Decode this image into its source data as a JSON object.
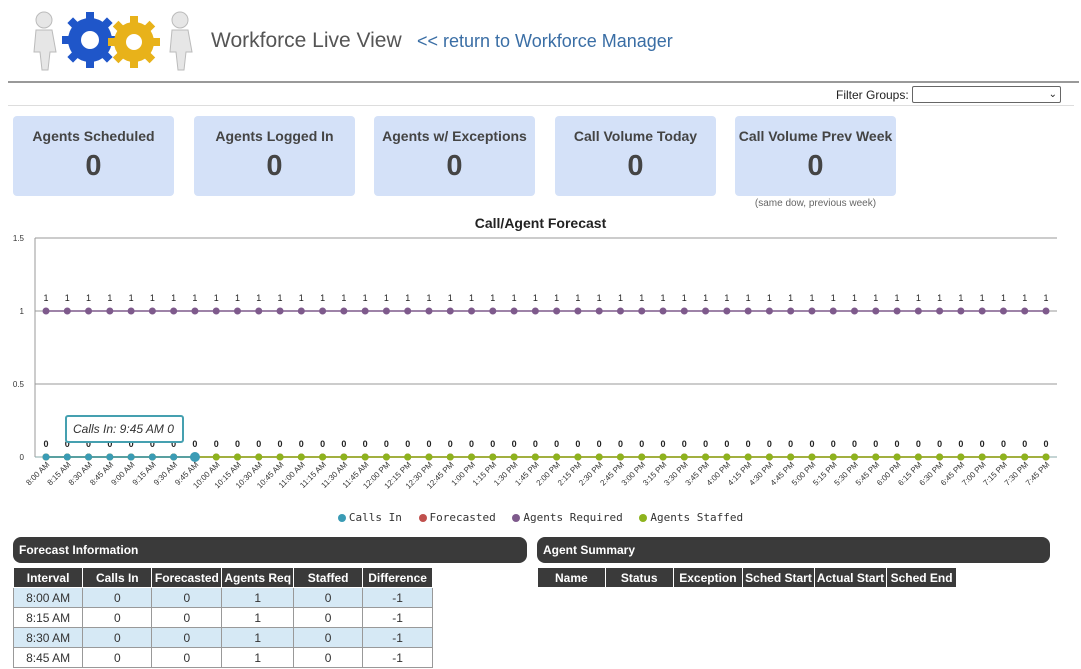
{
  "header": {
    "title": "Workforce Live View",
    "return_link": "<< return to Workforce Manager"
  },
  "filter": {
    "label": "Filter Groups:",
    "value": ""
  },
  "kpis": [
    {
      "label": "Agents Scheduled",
      "value": "0"
    },
    {
      "label": "Agents Logged In",
      "value": "0"
    },
    {
      "label": "Agents w/ Exceptions",
      "value": "0"
    },
    {
      "label": "Call Volume Today",
      "value": "0"
    },
    {
      "label": "Call Volume Prev Week",
      "value": "0"
    }
  ],
  "kpi_note": "(same dow, previous week)",
  "chart_data": {
    "type": "line",
    "title": "Call/Agent Forecast",
    "xlabel": "",
    "ylabel": "",
    "ylim": [
      0,
      1.5
    ],
    "yticks": [
      "0",
      "0.5",
      "1",
      "1.5"
    ],
    "grid": true,
    "legend_position": "bottom",
    "categories": [
      "8:00 AM",
      "8:15 AM",
      "8:30 AM",
      "8:45 AM",
      "9:00 AM",
      "9:15 AM",
      "9:30 AM",
      "9:45 AM",
      "10:00 AM",
      "10:15 AM",
      "10:30 AM",
      "10:45 AM",
      "11:00 AM",
      "11:15 AM",
      "11:30 AM",
      "11:45 AM",
      "12:00 PM",
      "12:15 PM",
      "12:30 PM",
      "12:45 PM",
      "1:00 PM",
      "1:15 PM",
      "1:30 PM",
      "1:45 PM",
      "2:00 PM",
      "2:15 PM",
      "2:30 PM",
      "2:45 PM",
      "3:00 PM",
      "3:15 PM",
      "3:30 PM",
      "3:45 PM",
      "4:00 PM",
      "4:15 PM",
      "4:30 PM",
      "4:45 PM",
      "5:00 PM",
      "5:15 PM",
      "5:30 PM",
      "5:45 PM",
      "6:00 PM",
      "6:15 PM",
      "6:30 PM",
      "6:45 PM",
      "7:00 PM",
      "7:15 PM",
      "7:30 PM",
      "7:45 PM"
    ],
    "series": [
      {
        "name": "Calls In",
        "color": "#3a9bb5",
        "values": [
          0,
          0,
          0,
          0,
          0,
          0,
          0,
          0
        ]
      },
      {
        "name": "Forecasted",
        "color": "#c0504d",
        "values": [
          0,
          0,
          0,
          0,
          0,
          0,
          0,
          0,
          0,
          0,
          0,
          0,
          0,
          0,
          0,
          0,
          0,
          0,
          0,
          0,
          0,
          0,
          0,
          0,
          0,
          0,
          0,
          0,
          0,
          0,
          0,
          0,
          0,
          0,
          0,
          0,
          0,
          0,
          0,
          0,
          0,
          0,
          0,
          0,
          0,
          0,
          0,
          0
        ]
      },
      {
        "name": "Agents Required",
        "color": "#7e5a8c",
        "values": [
          1,
          1,
          1,
          1,
          1,
          1,
          1,
          1,
          1,
          1,
          1,
          1,
          1,
          1,
          1,
          1,
          1,
          1,
          1,
          1,
          1,
          1,
          1,
          1,
          1,
          1,
          1,
          1,
          1,
          1,
          1,
          1,
          1,
          1,
          1,
          1,
          1,
          1,
          1,
          1,
          1,
          1,
          1,
          1,
          1,
          1,
          1,
          1
        ]
      },
      {
        "name": "Agents Staffed",
        "color": "#8db31e",
        "values": [
          0,
          0,
          0,
          0,
          0,
          0,
          0,
          0,
          0,
          0,
          0,
          0,
          0,
          0,
          0,
          0,
          0,
          0,
          0,
          0,
          0,
          0,
          0,
          0,
          0,
          0,
          0,
          0,
          0,
          0,
          0,
          0,
          0,
          0,
          0,
          0,
          0,
          0,
          0,
          0,
          0,
          0,
          0,
          0,
          0,
          0,
          0,
          0
        ]
      }
    ],
    "tooltip": "Calls In: 9:45 AM 0"
  },
  "forecast_panel": {
    "title": "Forecast Information",
    "columns": [
      "Interval",
      "Calls In",
      "Forecasted",
      "Agents Req",
      "Staffed",
      "Difference"
    ],
    "rows": [
      [
        "8:00 AM",
        "0",
        "0",
        "1",
        "0",
        "-1"
      ],
      [
        "8:15 AM",
        "0",
        "0",
        "1",
        "0",
        "-1"
      ],
      [
        "8:30 AM",
        "0",
        "0",
        "1",
        "0",
        "-1"
      ],
      [
        "8:45 AM",
        "0",
        "0",
        "1",
        "0",
        "-1"
      ]
    ]
  },
  "agent_panel": {
    "title": "Agent Summary",
    "columns": [
      "Name",
      "Status",
      "Exception",
      "Sched Start",
      "Actual Start",
      "Sched End"
    ]
  },
  "colors": {
    "kpi_bg": "#d4e1f8",
    "panel_bg": "#3a3a3a",
    "row_alt": "#d6e9f5",
    "link": "#3a6ea5"
  }
}
